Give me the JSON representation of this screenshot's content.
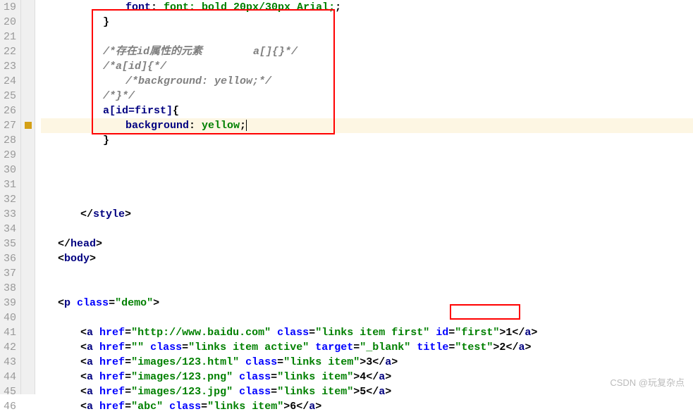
{
  "gutter": {
    "start": 19,
    "end": 46
  },
  "marker_line": 27,
  "code": {
    "l19": {
      "text": "font: bold 20px/30px Arial;"
    },
    "l20": {
      "text": "}"
    },
    "l21": {
      "text": ""
    },
    "l22": {
      "comment1": "/*存在id属性的元素",
      "comment2": "a[]{}*/"
    },
    "l23": {
      "comment": "/*a[id]{*/"
    },
    "l24": {
      "comment": "/*background: yellow;*/"
    },
    "l25": {
      "comment": "/*}*/"
    },
    "l26": {
      "selector": "a[id=first]",
      "brace": "{"
    },
    "l27": {
      "prop": "background",
      "value": "yellow"
    },
    "l28": {
      "brace": "}"
    },
    "l29": {
      "text": ""
    },
    "l30": {
      "text": ""
    },
    "l31": {
      "text": ""
    },
    "l32": {
      "text": ""
    },
    "l33": {
      "close_tag": "style"
    },
    "l34": {
      "text": ""
    },
    "l35": {
      "close_tag": "head"
    },
    "l36": {
      "open_tag": "body"
    },
    "l37": {
      "text": ""
    },
    "l38": {
      "text": ""
    },
    "l39": {
      "tag": "p",
      "attr": "class",
      "val": "demo"
    },
    "l40": {
      "text": ""
    },
    "l41": {
      "tag": "a",
      "href": "http://www.baidu.com",
      "class": "links item first",
      "id": "first",
      "content": "1"
    },
    "l42": {
      "tag": "a",
      "href": "",
      "class": "links item active",
      "target": "_blank",
      "title": "test",
      "content": "2"
    },
    "l43": {
      "tag": "a",
      "href": "images/123.html",
      "class": "links item",
      "content": "3"
    },
    "l44": {
      "tag": "a",
      "href": "images/123.png",
      "class": "links item",
      "content": "4"
    },
    "l45": {
      "tag": "a",
      "href": "images/123.jpg",
      "class": "links item",
      "content": "5"
    },
    "l46": {
      "tag": "a",
      "href": "abc",
      "class": "links item",
      "content": "6"
    }
  },
  "watermark": "CSDN @玩复杂点"
}
